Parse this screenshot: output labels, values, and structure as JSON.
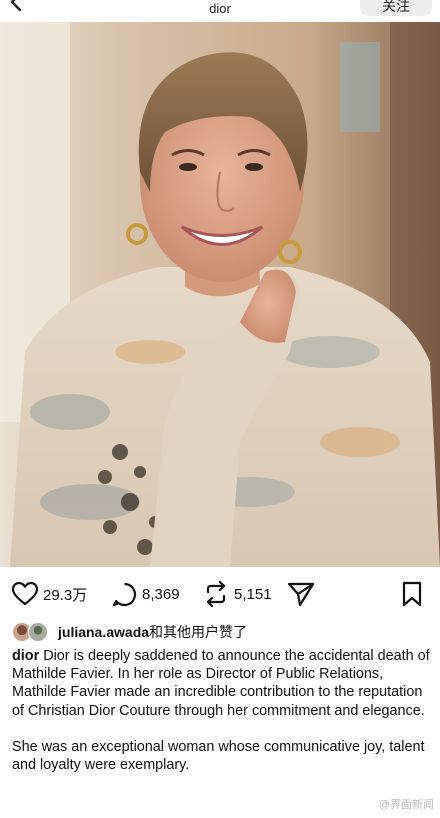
{
  "header": {
    "title": "dior",
    "follow_label": "关注",
    "back_icon": "chevron-left-icon"
  },
  "post": {
    "image_alt": "photo of a smiling woman with short hair in a knit sweater"
  },
  "actions": {
    "like_count": "29.3万",
    "comment_count": "8,369",
    "repost_count": "5,151",
    "icons": [
      "heart-icon",
      "comment-icon",
      "repost-icon",
      "send-icon",
      "bookmark-icon"
    ]
  },
  "likes": {
    "user": "juliana.awada",
    "suffix": "和其他用户赞了"
  },
  "caption": {
    "username": "dior",
    "paragraph1": "Dior is deeply saddened to announce the accidental death of Mathilde Favier. In her role as Director of Public Relations, Mathilde Favier made an incredible contribution to the reputation of Christian Dior Couture through her commitment and elegance.",
    "paragraph2": "She was an exceptional woman whose communicative joy, talent and loyalty were exemplary."
  },
  "watermark": "@界面新闻",
  "colors": {
    "background": "#ffffff",
    "text": "#111111",
    "follow_button_bg": "#eeeeee"
  }
}
